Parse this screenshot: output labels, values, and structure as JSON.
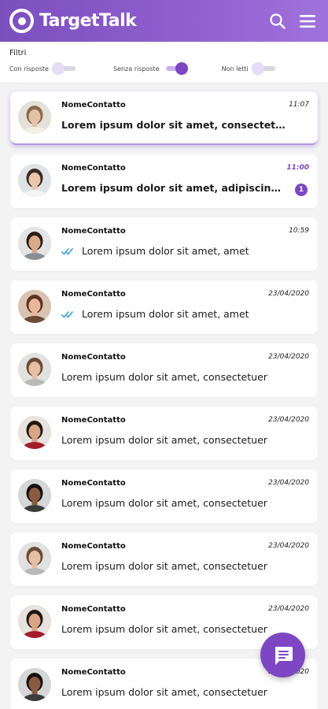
{
  "app": {
    "title": "TargetTalk"
  },
  "colors": {
    "brand": "#7c46c4",
    "header_start": "#7b4fbd",
    "header_end": "#a072dc",
    "unread": "#7c46c4",
    "ticks": "#3aa0d8"
  },
  "header": {
    "search_icon": "search-icon",
    "menu_icon": "menu-icon"
  },
  "filters": {
    "title": "Filtri",
    "items": [
      {
        "label": "Con risposte",
        "on": false
      },
      {
        "label": "Senza risposte",
        "on": true
      },
      {
        "label": "Non letti",
        "on": false
      }
    ]
  },
  "conversations": [
    {
      "name": "NomeContatto",
      "time": "11:07",
      "message": "Lorem ipsum dolor sit amet, consectetuer…",
      "bold": true,
      "unread": false,
      "ticks": false,
      "selected": true,
      "avatar": {
        "skin": "#e3c2a6",
        "hair": "#8a6a4d",
        "shirt": "#f2efe9",
        "bg": "#e6e0da"
      }
    },
    {
      "name": "NomeContatto",
      "time": "11:00",
      "message": "Lorem ipsum dolor sit amet, adipiscing…",
      "bold": true,
      "unread": true,
      "badge": "1",
      "ticks": false,
      "selected": false,
      "avatar": {
        "skin": "#eac7ae",
        "hair": "#3b2a22",
        "shirt": "#f4f4f4",
        "bg": "#dfe3e6"
      }
    },
    {
      "name": "NomeContatto",
      "time": "10:59",
      "message": "Lorem ipsum dolor sit amet, amet",
      "bold": false,
      "unread": false,
      "ticks": true,
      "selected": false,
      "avatar": {
        "skin": "#d9a98a",
        "hair": "#2a1d16",
        "shirt": "#8a8f96",
        "bg": "#e4e4e4"
      }
    },
    {
      "name": "NomeContatto",
      "time": "23/04/2020",
      "message": "Lorem ipsum dolor sit amet, amet",
      "bold": false,
      "unread": false,
      "ticks": true,
      "selected": false,
      "avatar": {
        "skin": "#e8b79c",
        "hair": "#5a3220",
        "shirt": "#6b4a3a",
        "bg": "#d9c3b0"
      }
    },
    {
      "name": "NomeContatto",
      "time": "23/04/2020",
      "message": "Lorem ipsum dolor sit amet, consectetuer",
      "bold": false,
      "unread": false,
      "ticks": false,
      "selected": false,
      "avatar": {
        "skin": "#e6c0a4",
        "hair": "#6a4b33",
        "shirt": "#b9b9b9",
        "bg": "#e1e1df"
      }
    },
    {
      "name": "NomeContatto",
      "time": "23/04/2020",
      "message": "Lorem ipsum dolor sit amet, consectetuer",
      "bold": false,
      "unread": false,
      "ticks": false,
      "selected": false,
      "avatar": {
        "skin": "#d8a585",
        "hair": "#1e1612",
        "shirt": "#a31c2a",
        "bg": "#e7e2de"
      }
    },
    {
      "name": "NomeContatto",
      "time": "23/04/2020",
      "message": "Lorem ipsum dolor sit amet, consectetuer",
      "bold": false,
      "unread": false,
      "ticks": false,
      "selected": false,
      "avatar": {
        "skin": "#8a5b3f",
        "hair": "#141010",
        "shirt": "#3c3c3c",
        "bg": "#d6d6d6"
      }
    },
    {
      "name": "NomeContatto",
      "time": "23/04/2020",
      "message": "Lorem ipsum dolor sit amet, consectetuer",
      "bold": false,
      "unread": false,
      "ticks": false,
      "selected": false,
      "avatar": {
        "skin": "#e6c0a4",
        "hair": "#6a4b33",
        "shirt": "#b9b9b9",
        "bg": "#e1e1df"
      }
    },
    {
      "name": "NomeContatto",
      "time": "23/04/2020",
      "message": "Lorem ipsum dolor sit amet, consectetuer",
      "bold": false,
      "unread": false,
      "ticks": false,
      "selected": false,
      "avatar": {
        "skin": "#d8a585",
        "hair": "#1e1612",
        "shirt": "#a31c2a",
        "bg": "#e7e2de"
      }
    },
    {
      "name": "NomeContatto",
      "time": "23/04/2020",
      "message": "Lorem ipsum dolor sit amet, consectetuer",
      "bold": false,
      "unread": false,
      "ticks": false,
      "selected": false,
      "avatar": {
        "skin": "#8a5b3f",
        "hair": "#141010",
        "shirt": "#3c3c3c",
        "bg": "#d6d6d6"
      }
    }
  ],
  "fab": {
    "icon": "chat-icon"
  }
}
